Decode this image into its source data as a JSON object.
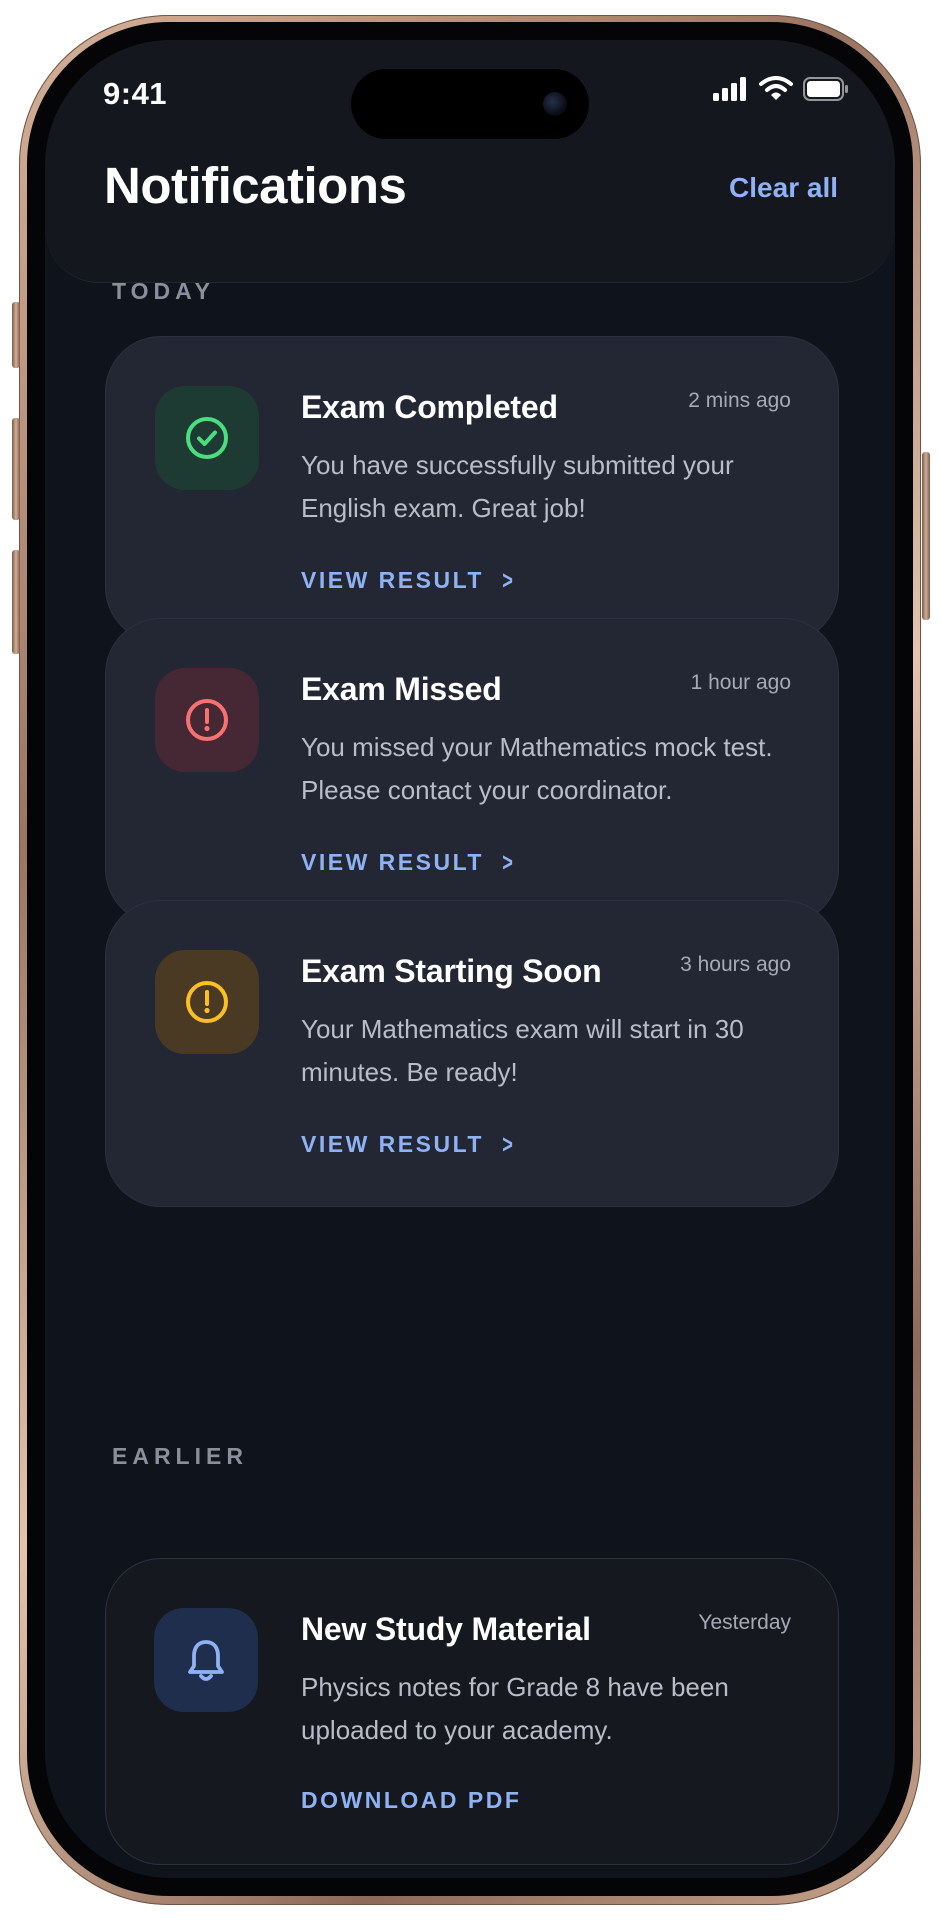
{
  "status_bar": {
    "time": "9:41"
  },
  "header": {
    "title": "Notifications",
    "clear_all_label": "Clear all"
  },
  "sections": {
    "today_label": "TODAY",
    "earlier_label": "EARLIER"
  },
  "notifications": [
    {
      "title": "Exam Completed",
      "time": "2 mins ago",
      "body": "You have successfully submitted your English exam. Great job!",
      "action": "VIEW RESULT",
      "icon": "check-circle-icon",
      "accent": "#4ade80",
      "tile_bg": "#1d3b33"
    },
    {
      "title": "Exam Missed",
      "time": "1 hour ago",
      "body": "You missed your Mathematics mock test. Please contact your coordinator.",
      "action": "VIEW RESULT",
      "icon": "alert-circle-icon",
      "accent": "#f87171",
      "tile_bg": "#452833"
    },
    {
      "title": "Exam Starting Soon",
      "time": "3 hours ago",
      "body": "Your Mathematics exam will start in 30 minutes. Be ready!",
      "action": "VIEW RESULT",
      "icon": "alert-circle-icon",
      "accent": "#fbbf24",
      "tile_bg": "#4a3a24"
    },
    {
      "title": "New Study Material",
      "time": "Yesterday",
      "body": "Physics notes for Grade 8 have been uploaded to your academy.",
      "action": "DOWNLOAD PDF",
      "icon": "bell-icon",
      "accent": "#8fb2f5",
      "tile_bg": "#1f2e4d"
    }
  ],
  "theme": {
    "screen_bg": "#0f131b",
    "card_bg": "#232633",
    "link_color": "#8fb2f5"
  }
}
